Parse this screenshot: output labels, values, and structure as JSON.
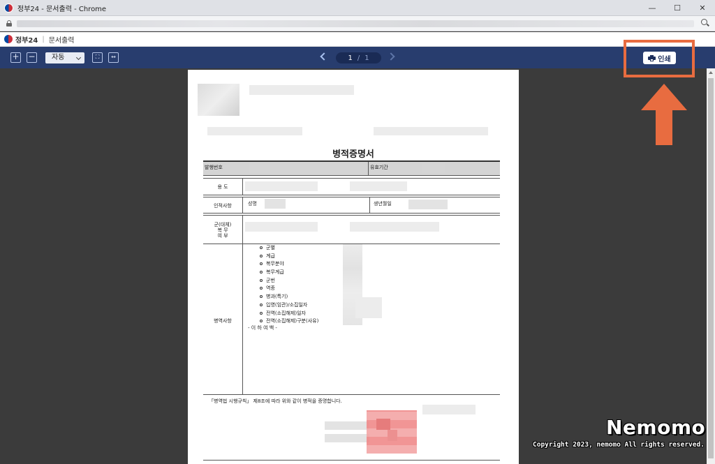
{
  "window": {
    "title": "정부24 - 문서출력 - Chrome",
    "controls": {
      "minimize": "—",
      "maximize": "☐",
      "close": "✕"
    }
  },
  "site": {
    "brand": "정부24",
    "separator": "|",
    "section": "문서출력"
  },
  "toolbar": {
    "zoom_in": "+",
    "zoom_out": "−",
    "zoom_mode": "자동",
    "page_current": "1",
    "page_separator": "/",
    "page_total": "1",
    "print_label": "인쇄"
  },
  "document": {
    "title": "병적증명서",
    "fields": {
      "issue_no": "발행번호",
      "valid_period": "유효기간",
      "purpose": "용    도",
      "personal_info": "인적사항",
      "name": "성명",
      "birth_date": "생년월일",
      "military_line1": "군(대체)",
      "military_line2": "복    무",
      "military_line3": "여    부",
      "service_section": "병역사항"
    },
    "service_items": [
      "군별",
      "계급",
      "복무분야",
      "복무계급",
      "군번",
      "역종",
      "병과(특기)",
      "입영(임관)/소집일자",
      "전역(소집해제)일자",
      "전역(소집해제)구분(사유)"
    ],
    "end_mark": "- 이 하 여 백 -",
    "certification_text": "「병역법 시행규칙」 제8조에 따라 위와 같이 병적을 증명합니다."
  },
  "watermark": {
    "title": "Nemomo",
    "copyright": "Copyright 2023, nemomo All rights reserved."
  },
  "colors": {
    "toolbar_bg": "#283d6e",
    "highlight": "#e86c40",
    "viewer_bg": "#3b3b3b"
  }
}
